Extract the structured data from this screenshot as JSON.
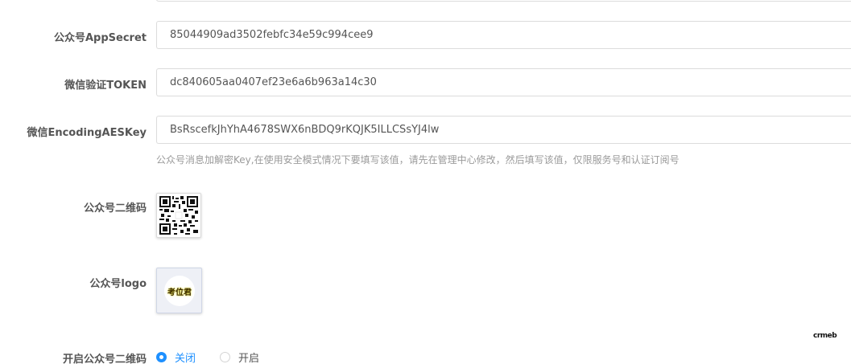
{
  "form": {
    "app_secret": {
      "label": "公众号AppSecret",
      "value": "85044909ad3502febfc34e59c994cee9"
    },
    "token": {
      "label": "微信验证TOKEN",
      "value": "dc840605aa0407ef23e6a6b963a14c30"
    },
    "aes_key": {
      "label": "微信EncodingAESKey",
      "value": "BsRscefkJhYhA4678SWX6nBDQ9rKQJK5ILLCSsYJ4lw",
      "help": "公众号消息加解密Key,在使用安全模式情况下要填写该值，请先在管理中心修改，然后填写该值，仅限服务号和认证订阅号"
    },
    "qrcode": {
      "label": "公众号二维码",
      "icon": "qr-code-icon"
    },
    "logo": {
      "label": "公众号logo",
      "text": "考位君"
    },
    "qrcode_toggle": {
      "label": "开启公众号二维码",
      "options": [
        "关闭",
        "开启"
      ],
      "selected": "关闭",
      "accent": "#1e90ff"
    }
  },
  "watermark": "crmeb"
}
